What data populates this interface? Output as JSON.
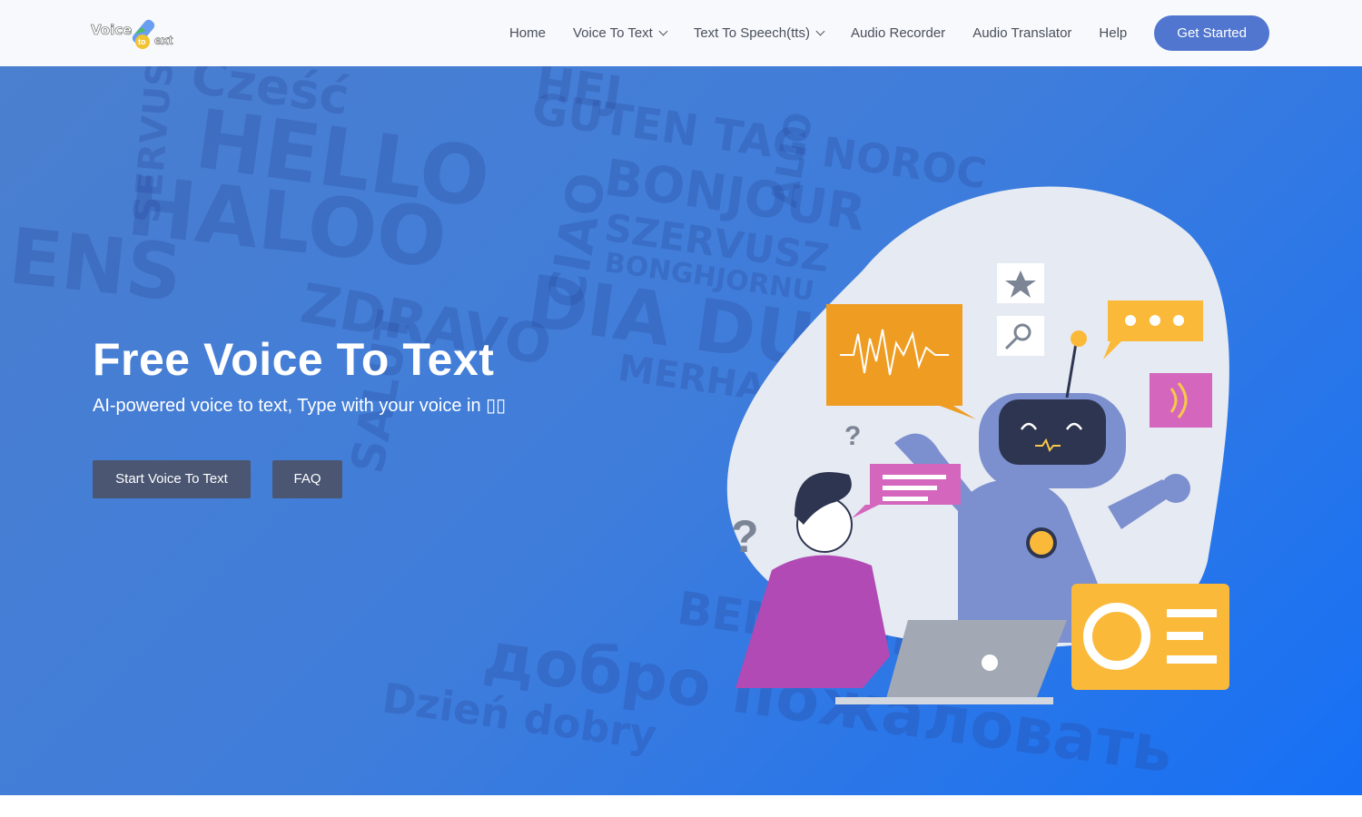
{
  "logo": {
    "text": "Voice to Text"
  },
  "nav": {
    "items": [
      {
        "label": "Home",
        "dropdown": false
      },
      {
        "label": "Voice To Text",
        "dropdown": true
      },
      {
        "label": "Text To Speech(tts)",
        "dropdown": true
      },
      {
        "label": "Audio Recorder",
        "dropdown": false
      },
      {
        "label": "Audio Translator",
        "dropdown": false
      },
      {
        "label": "Help",
        "dropdown": false
      }
    ],
    "cta": "Get Started"
  },
  "hero": {
    "title": "Free Voice To Text",
    "subtitle": "AI-powered voice to text, Type with your voice in ▯▯",
    "start_button": "Start Voice To Text",
    "faq_button": "FAQ",
    "background_words": [
      "HELLO",
      "HALOO",
      "Cześć",
      "GUTEN TAG",
      "BONJOUR",
      "SZERVUSZ",
      "BONGHJORNU",
      "DIA DUIT",
      "ZDRAVO",
      "CIAO",
      "NOROC",
      "MERHABA",
      "BEM-VINDO",
      "добро пожаловать",
      "ENS",
      "HEJ",
      "SALUT",
      "Dzień dobry",
      "SERVUS",
      "ALIO"
    ]
  },
  "colors": {
    "accent": "#5176cf",
    "button": "#4a5672",
    "hero_start": "#4b7fcf",
    "hero_end": "#1670f5"
  }
}
